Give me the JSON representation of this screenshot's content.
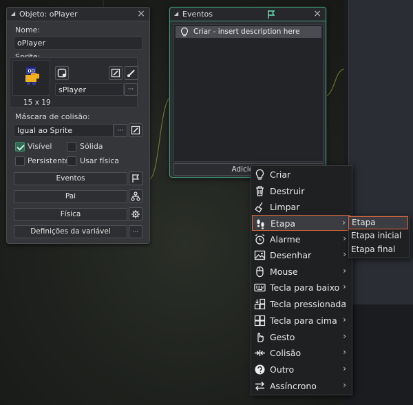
{
  "object_panel": {
    "title": "Objeto: oPlayer",
    "name_label": "Nome:",
    "name_value": "oPlayer",
    "sprite_label": "Sprite:",
    "sprite_name": "sPlayer",
    "sprite_size": "15 x 19",
    "ellipsis": "···",
    "mask_label": "Máscara de colisão:",
    "mask_value": "Igual ao Sprite",
    "checkbox_visible": "Visível",
    "checkbox_solid": "Sólida",
    "checkbox_persistent": "Persistente",
    "checkbox_physics": "Usar física",
    "events_button": "Eventos",
    "parent_button": "Pai",
    "physics_button": "Física",
    "variables_button": "Definições da variável"
  },
  "events_panel": {
    "title": "Eventos",
    "event_item": "Criar - insert description here",
    "add_button": "Adicionar"
  },
  "context_menu": {
    "items": [
      {
        "label": "Criar",
        "icon": "lightbulb-icon",
        "submenu": false
      },
      {
        "label": "Destruir",
        "icon": "trash-icon",
        "submenu": false
      },
      {
        "label": "Limpar",
        "icon": "broom-icon",
        "submenu": false
      },
      {
        "label": "Etapa",
        "icon": "footsteps-icon",
        "submenu": true
      },
      {
        "label": "Alarme",
        "icon": "alarm-clock-icon",
        "submenu": true
      },
      {
        "label": "Desenhar",
        "icon": "picture-icon",
        "submenu": true
      },
      {
        "label": "Mouse",
        "icon": "mouse-icon",
        "submenu": true
      },
      {
        "label": "Tecla para baixo",
        "icon": "keyboard-icon",
        "submenu": true
      },
      {
        "label": "Tecla pressionada",
        "icon": "key-pressed-icon",
        "submenu": true
      },
      {
        "label": "Tecla para cima",
        "icon": "key-up-icon",
        "submenu": true
      },
      {
        "label": "Gesto",
        "icon": "hand-gesture-icon",
        "submenu": true
      },
      {
        "label": "Colisão",
        "icon": "collision-icon",
        "submenu": true
      },
      {
        "label": "Outro",
        "icon": "other-icon",
        "submenu": true
      },
      {
        "label": "Assíncrono",
        "icon": "async-icon",
        "submenu": true
      }
    ],
    "submenu_arrow": "›"
  },
  "step_submenu": {
    "items": [
      "Etapa",
      "Etapa inicial",
      "Etapa final"
    ]
  },
  "colors": {
    "accent_green": "#3f9a7a",
    "highlight_orange": "#e0683a"
  }
}
